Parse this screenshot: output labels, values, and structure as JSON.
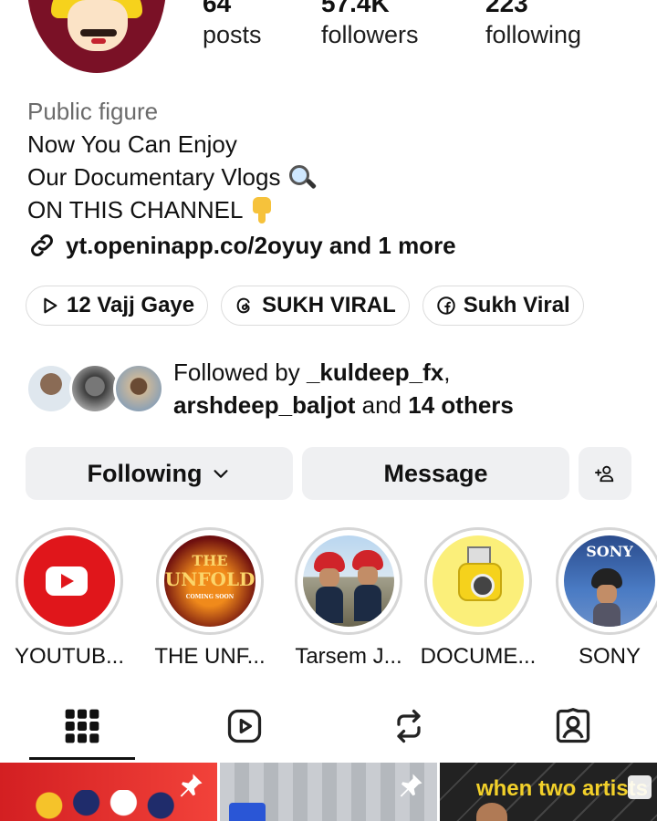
{
  "profile": {
    "stats": {
      "posts": {
        "value": "64",
        "label": "posts"
      },
      "followers": {
        "value": "57.4K",
        "label": "followers"
      },
      "following": {
        "value": "223",
        "label": "following"
      }
    },
    "category": "Public figure",
    "bio_lines": [
      "Now You Can Enjoy",
      "Our Documentary Vlogs",
      "ON THIS CHANNEL"
    ],
    "link_text": "yt.openinapp.co/2oyuy and 1 more"
  },
  "chips": [
    {
      "label": "12 Vajj Gaye",
      "icon": "play-icon"
    },
    {
      "label": "SUKH VIRAL",
      "icon": "threads-icon"
    },
    {
      "label": "Sukh Viral",
      "icon": "facebook-icon"
    }
  ],
  "mutuals": {
    "prefix": "Followed by",
    "user1": "_kuldeep_fx",
    "comma": ",",
    "user2": "arshdeep_baljot",
    "and": "and",
    "others": "14 others"
  },
  "actions": {
    "following_label": "Following",
    "message_label": "Message"
  },
  "highlights": [
    {
      "label": "YOUTUB..."
    },
    {
      "label": "THE UNF..."
    },
    {
      "label": "Tarsem J..."
    },
    {
      "label": "DOCUME..."
    },
    {
      "label": "SONY"
    }
  ],
  "highlight_art": {
    "unfold_line1": "THE",
    "unfold_line2": "UNFOLD",
    "unfold_line3": "COMING SOON",
    "sony_text": "SONY"
  },
  "grid_posts": {
    "post3_text": "when two artists"
  },
  "colors": {
    "accent_red": "#e0161b",
    "button_bg": "#eff0f2",
    "category_grey": "#6b6b6b"
  }
}
